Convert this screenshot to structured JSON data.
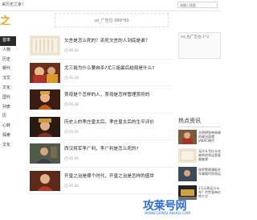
{
  "topbar": {
    "welcome": "来历史之家！",
    "search_placeholder": "请输入搜索"
  },
  "logo": {
    "text": "之家"
  },
  "ads": {
    "top": "sd_广告位-988*60",
    "side": "sd_右广告位-1*3"
  },
  "nav": [
    "首率",
    "人物",
    "历史",
    "朝代",
    "汉文",
    "文化",
    "国代",
    "列表",
    "历",
    "心转",
    "探索",
    "文化"
  ],
  "articles": [
    {
      "title": "文言是怎么死的？杀死文言的人到底是谁？",
      "date": "05-28"
    },
    {
      "title": "尤三姐为什么要自杀?尤三姐最后结局是什么?",
      "date": "05-28"
    },
    {
      "title": "贾母是个怎样的人，贾母是怎样管理贾府的",
      "date": "05-28"
    },
    {
      "title": "历史上的孝庄皇太后，孝庄皇太后的生平评价",
      "date": "05-28"
    },
    {
      "title": "西汉将军李广利，李广利是怎么死的?",
      "date": "05-28"
    },
    {
      "title": "开皇之治是哪个时代，开皇之治是怎样的盛世",
      "date": "05-28"
    }
  ],
  "hot": {
    "heading": "热点资讯",
    "items": [
      "北明明皇帝朱棣的政治成就JABAC朝代",
      "无什么为什么在被杀的命运是谁被被害",
      "秘率警察通报开车事情代的命运",
      "1万元购买什么车？代宗皇帝价格大全",
      "介绍古代的历史事件"
    ]
  },
  "watermark": {
    "title": "攻莱号网",
    "subtitle": "WWW.GONGLAIHAO.COM"
  },
  "colors": {
    "nav_active": "#2a2a2a",
    "logo": "#e8a41b",
    "watermark": "#2f6fd3"
  }
}
